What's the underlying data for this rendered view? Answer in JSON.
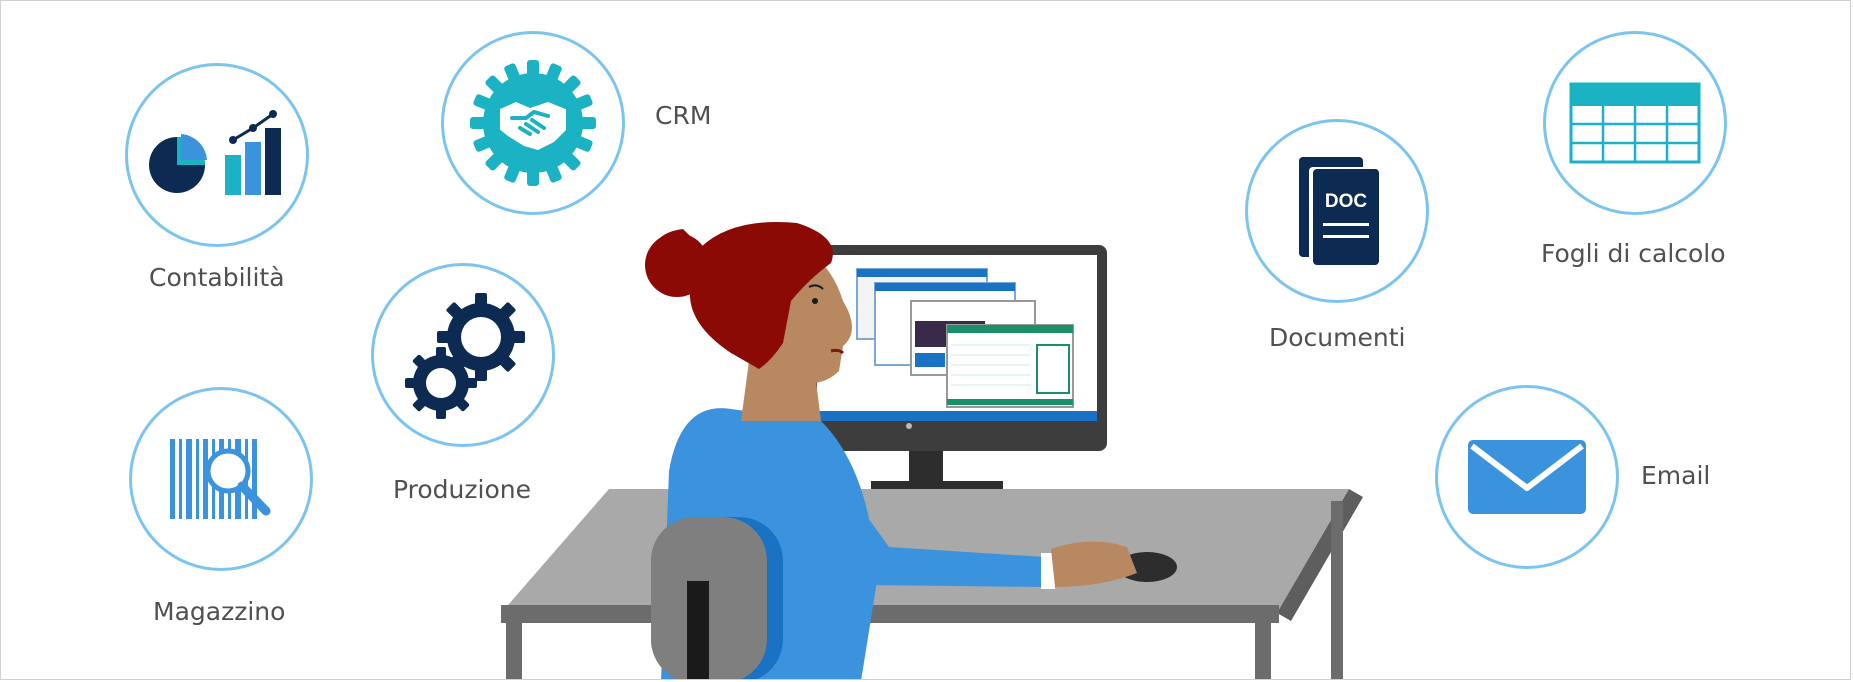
{
  "categories": [
    {
      "id": "contabilita",
      "label": "Contabilità",
      "icon": "pie-and-bar-chart-icon"
    },
    {
      "id": "crm",
      "label": "CRM",
      "icon": "handshake-gear-icon"
    },
    {
      "id": "produzione",
      "label": "Produzione",
      "icon": "gears-icon"
    },
    {
      "id": "magazzino",
      "label": "Magazzino",
      "icon": "barcode-search-icon"
    },
    {
      "id": "documenti",
      "label": "Documenti",
      "icon": "doc-file-icon",
      "icon_text": "DOC"
    },
    {
      "id": "fogli",
      "label": "Fogli di calcolo",
      "icon": "spreadsheet-icon"
    },
    {
      "id": "email",
      "label": "Email",
      "icon": "envelope-icon"
    }
  ],
  "colors": {
    "ring": "#7cc4f0",
    "navy": "#0d2a52",
    "teal": "#1bb2c4",
    "blue": "#3b93dd",
    "hair": "#8b0a06",
    "skin": "#b88860",
    "desk": "#a9a9a9",
    "chair": "#7f7f7f"
  }
}
